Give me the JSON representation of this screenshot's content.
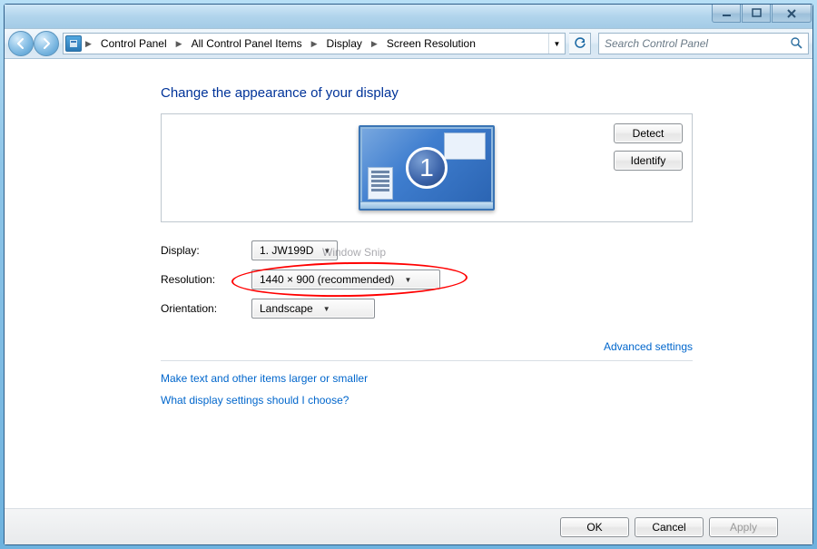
{
  "breadcrumbs": [
    "Control Panel",
    "All Control Panel Items",
    "Display",
    "Screen Resolution"
  ],
  "search": {
    "placeholder": "Search Control Panel"
  },
  "heading": "Change the appearance of your display",
  "monitor": {
    "number": "1"
  },
  "buttons": {
    "detect": "Detect",
    "identify": "Identify",
    "ok": "OK",
    "cancel": "Cancel",
    "apply": "Apply"
  },
  "form": {
    "display_label": "Display:",
    "display_value": "1. JW199D",
    "resolution_label": "Resolution:",
    "resolution_value": "1440 × 900 (recommended)",
    "orientation_label": "Orientation:",
    "orientation_value": "Landscape"
  },
  "links": {
    "advanced": "Advanced settings",
    "larger": "Make text and other items larger or smaller",
    "help": "What display settings should I choose?"
  },
  "watermark": "Window Snip"
}
